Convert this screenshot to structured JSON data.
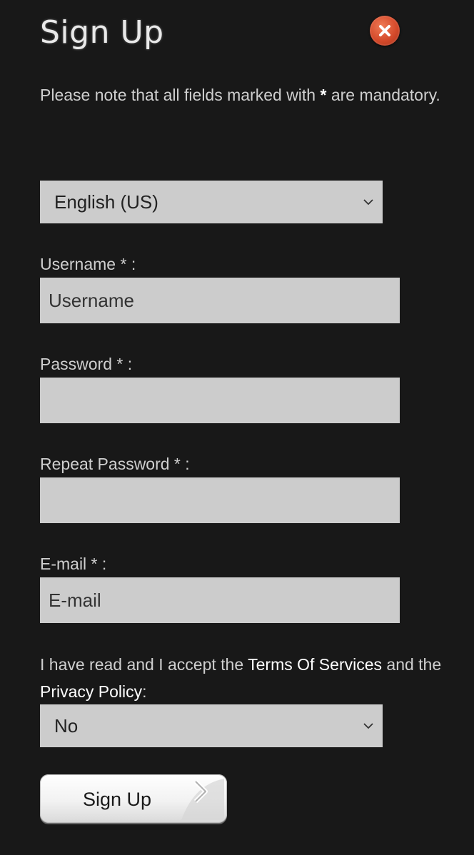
{
  "dialog": {
    "title": "Sign Up",
    "close_icon": "close-icon",
    "close_color": "#d44a2b"
  },
  "note": {
    "text_before": "Please note that all fields marked with",
    "star": "*",
    "text_after": "are mandatory."
  },
  "language_select": {
    "selected": "English (US)",
    "icon": "chevron-down-icon"
  },
  "fields": {
    "username": {
      "label": "Username * :",
      "placeholder": "Username",
      "value": ""
    },
    "password": {
      "label": "Password * :",
      "placeholder": "",
      "value": ""
    },
    "repeat_password": {
      "label": "Repeat Password * :",
      "placeholder": "",
      "value": ""
    },
    "email": {
      "label": "E-mail * :",
      "placeholder": "E-mail",
      "value": ""
    }
  },
  "terms": {
    "text_1": "I have read and I accept the",
    "tos_link": "Terms Of Services",
    "text_2": "and the",
    "privacy_link": "Privacy Policy",
    "text_3": ":"
  },
  "accept_select": {
    "selected": "No",
    "icon": "chevron-down-icon"
  },
  "submit": {
    "label": "Sign Up",
    "icon": "arrow-right-icon"
  },
  "colors": {
    "background": "#181818",
    "field_background": "#cccccc",
    "text": "#cfcfcf",
    "link": "#ffffff"
  }
}
